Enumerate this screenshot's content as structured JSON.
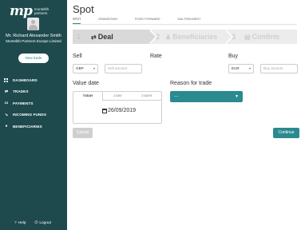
{
  "brand": {
    "mark": "mp",
    "name_line1": "montelith",
    "name_line2": "partners"
  },
  "user": {
    "name": "Mr. Richard Alexander Smith",
    "company": "Montelith Partners Europe Limited"
  },
  "sidebar": {
    "new_trade_label": "New trade",
    "items": [
      {
        "label": "DASHBOARD",
        "icon": "grid-icon"
      },
      {
        "label": "TRADES",
        "icon": "exchange-icon"
      },
      {
        "label": "PAYMENTS",
        "icon": "card-icon"
      },
      {
        "label": "INCOMING FUNDS",
        "icon": "arrow-in-icon"
      },
      {
        "label": "BENEFICIARIES",
        "icon": "person-icon"
      }
    ],
    "help_label": "Help",
    "logout_label": "Logout"
  },
  "page": {
    "title": "Spot"
  },
  "tabs": [
    {
      "label": "SPOT",
      "active": true
    },
    {
      "label": "DRAWDOWN",
      "active": false
    },
    {
      "label": "FIXED FORWARD",
      "active": false
    },
    {
      "label": "MULTIPAYMENT",
      "active": false
    }
  ],
  "steps": [
    {
      "num": "1",
      "label": "Deal",
      "icon": "exchange-icon",
      "active": true
    },
    {
      "num": "2",
      "label": "Beneficiaries",
      "icon": "people-icon",
      "active": false
    },
    {
      "num": "3",
      "label": "Confirm",
      "icon": "document-icon",
      "active": false
    }
  ],
  "form": {
    "sell_label": "Sell",
    "sell_currency": "GBP",
    "sell_amount_placeholder": "Sell amount",
    "rate_label": "Rate",
    "buy_label": "Buy",
    "buy_currency": "EUR",
    "buy_amount_placeholder": "Buy amount",
    "value_date_label": "Value date",
    "date_tabs": [
      "TODAY",
      "1 DAY",
      "2 DAYS"
    ],
    "date_value": "26/09/2019",
    "reason_label": "Reason for trade",
    "reason_value": "---"
  },
  "buttons": {
    "cancel": "Cancel",
    "continue": "Continue"
  },
  "colors": {
    "sidebar_bg": "#1e4a4e",
    "accent": "#2b8a8f"
  }
}
